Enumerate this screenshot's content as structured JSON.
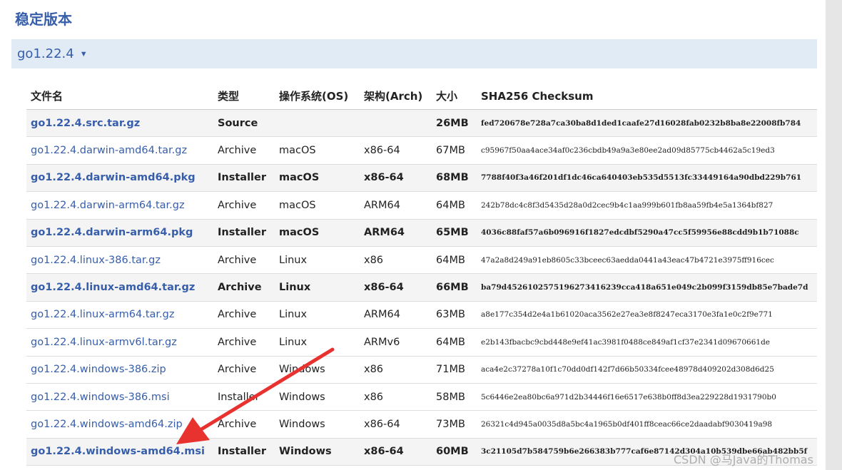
{
  "section_title": "稳定版本",
  "version": {
    "label": "go1.22.4",
    "caret": "▼"
  },
  "columns": [
    "文件名",
    "类型",
    "操作系统(OS)",
    "架构(Arch)",
    "大小",
    "SHA256 Checksum"
  ],
  "rows": [
    {
      "file": "go1.22.4.src.tar.gz",
      "kind": "Source",
      "os": "",
      "arch": "",
      "size": "26MB",
      "sha": "fed720678e728a7ca30ba8d1ded1caafe27d16028fab0232b8ba8e22008fb784",
      "highlight": true
    },
    {
      "file": "go1.22.4.darwin-amd64.tar.gz",
      "kind": "Archive",
      "os": "macOS",
      "arch": "x86-64",
      "size": "67MB",
      "sha": "c95967f50aa4ace34af0c236cbdb49a9a3e80ee2ad09d85775cb4462a5c19ed3",
      "highlight": false
    },
    {
      "file": "go1.22.4.darwin-amd64.pkg",
      "kind": "Installer",
      "os": "macOS",
      "arch": "x86-64",
      "size": "68MB",
      "sha": "7788f40f3a46f201df1dc46ca640403eb535d5513fc33449164a90dbd229b761",
      "highlight": true
    },
    {
      "file": "go1.22.4.darwin-arm64.tar.gz",
      "kind": "Archive",
      "os": "macOS",
      "arch": "ARM64",
      "size": "64MB",
      "sha": "242b78dc4c8f3d5435d28a0d2cec9b4c1aa999b601fb8aa59fb4e5a1364bf827",
      "highlight": false
    },
    {
      "file": "go1.22.4.darwin-arm64.pkg",
      "kind": "Installer",
      "os": "macOS",
      "arch": "ARM64",
      "size": "65MB",
      "sha": "4036c88faf57a6b096916f1827edcdbf5290a47cc5f59956e88cdd9b1b71088c",
      "highlight": true
    },
    {
      "file": "go1.22.4.linux-386.tar.gz",
      "kind": "Archive",
      "os": "Linux",
      "arch": "x86",
      "size": "64MB",
      "sha": "47a2a8d249a91eb8605c33bceec63aedda0441a43eac47b4721e3975ff916cec",
      "highlight": false
    },
    {
      "file": "go1.22.4.linux-amd64.tar.gz",
      "kind": "Archive",
      "os": "Linux",
      "arch": "x86-64",
      "size": "66MB",
      "sha": "ba79d4526102575196273416239cca418a651e049c2b099f3159db85e7bade7d",
      "highlight": true
    },
    {
      "file": "go1.22.4.linux-arm64.tar.gz",
      "kind": "Archive",
      "os": "Linux",
      "arch": "ARM64",
      "size": "63MB",
      "sha": "a8e177c354d2e4a1b61020aca3562e27ea3e8f8247eca3170e3fa1e0c2f9e771",
      "highlight": false
    },
    {
      "file": "go1.22.4.linux-armv6l.tar.gz",
      "kind": "Archive",
      "os": "Linux",
      "arch": "ARMv6",
      "size": "64MB",
      "sha": "e2b143fbacbc9cbd448e9ef41ac3981f0488ce849af1cf37e2341d09670661de",
      "highlight": false
    },
    {
      "file": "go1.22.4.windows-386.zip",
      "kind": "Archive",
      "os": "Windows",
      "arch": "x86",
      "size": "71MB",
      "sha": "aca4e2c37278a10f1c70dd0df142f7d66b50334fcee48978d409202d308d6d25",
      "highlight": false
    },
    {
      "file": "go1.22.4.windows-386.msi",
      "kind": "Installer",
      "os": "Windows",
      "arch": "x86",
      "size": "58MB",
      "sha": "5c6446e2ea80bc6a971d2b34446f16e6517e638b0ff8d3ea229228d1931790b0",
      "highlight": false
    },
    {
      "file": "go1.22.4.windows-amd64.zip",
      "kind": "Archive",
      "os": "Windows",
      "arch": "x86-64",
      "size": "73MB",
      "sha": "26321c4d945a0035d8a5bc4a1965b0df401ff8ceac66ce2daadabf9030419a98",
      "highlight": false
    },
    {
      "file": "go1.22.4.windows-amd64.msi",
      "kind": "Installer",
      "os": "Windows",
      "arch": "x86-64",
      "size": "60MB",
      "sha": "3c21105d7b584759b6e266383b777caf6e87142d304a10b539dbe66ab482bb5f",
      "highlight": true
    }
  ],
  "watermark": "CSDN @马Java的Thomas",
  "colors": {
    "link": "#375eab",
    "version_bar": "#e0ebf5",
    "highlight_row": "#f4f4f4",
    "arrow": "#e8322f"
  }
}
